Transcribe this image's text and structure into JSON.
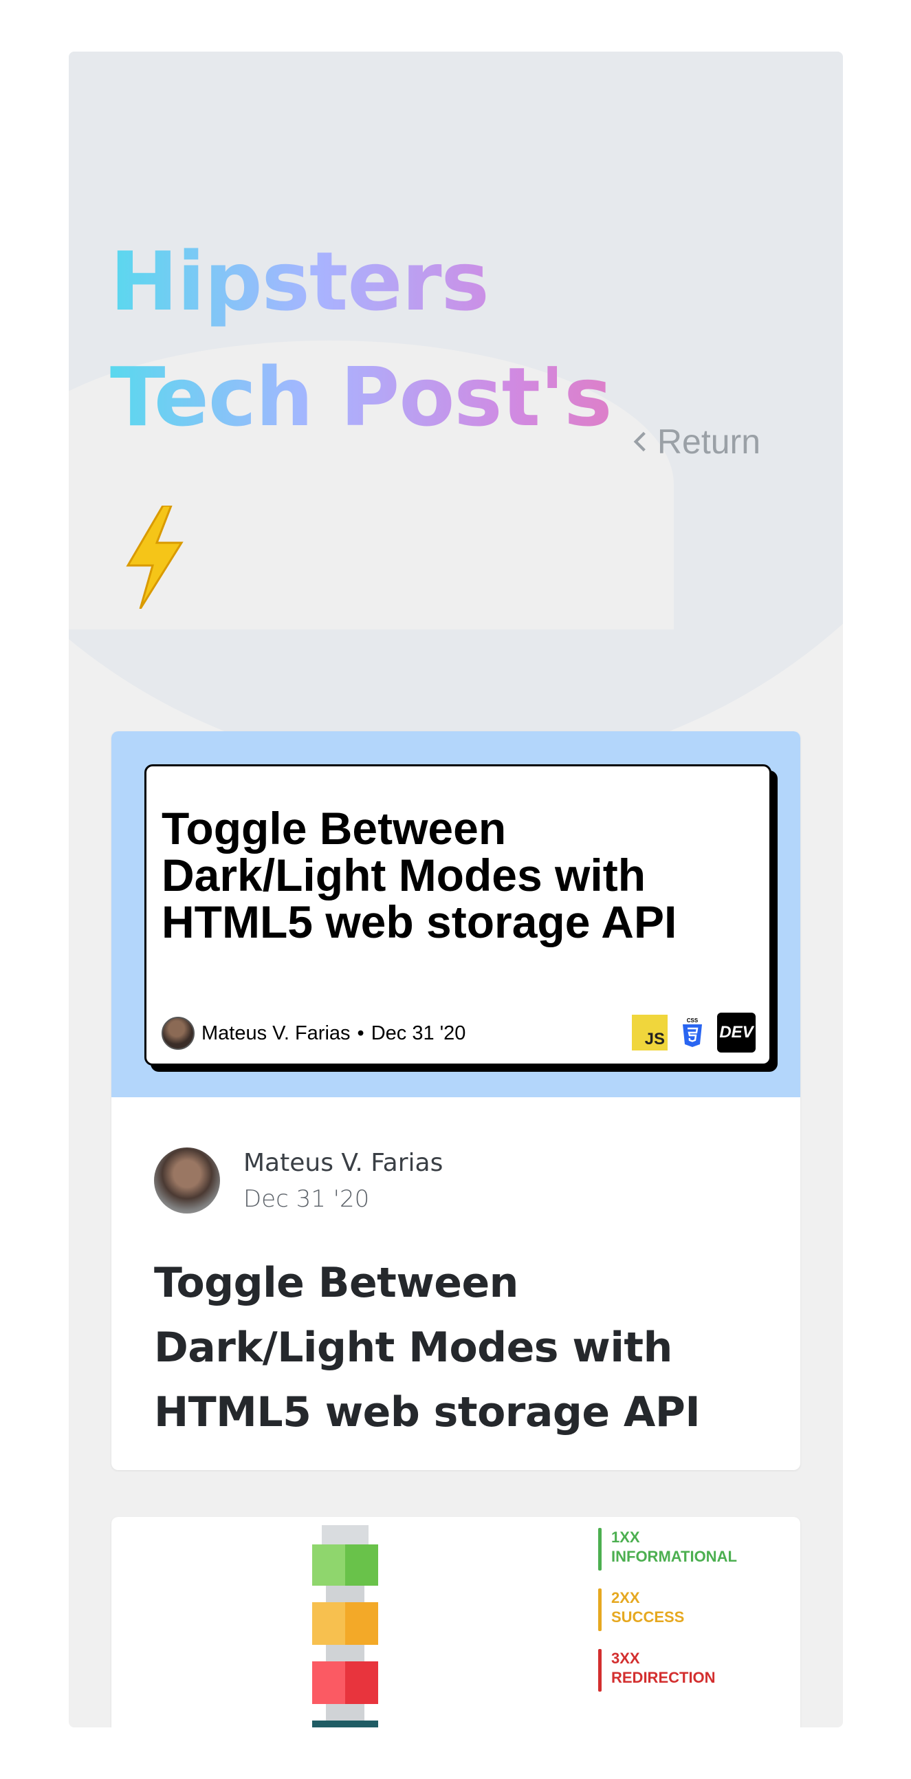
{
  "header": {
    "title_line1": "Hipsters",
    "title_line2": "Tech Post's",
    "emoji": "⚡",
    "return_label": "Return"
  },
  "posts": [
    {
      "cover": {
        "title": "Toggle Between Dark/Light Modes with HTML5 web storage API",
        "author": "Mateus V. Farias",
        "separator": "•",
        "date": "Dec 31 '20",
        "tags": [
          "JS",
          "CSS",
          "DEV"
        ]
      },
      "author": "Mateus V. Farias",
      "date": "Dec 31 '20",
      "title": "Toggle Between Dark/Light Modes with HTML5 web storage API"
    }
  ],
  "http_graphic": {
    "items": [
      {
        "code": "1XX",
        "label": "INFORMATIONAL",
        "color": "#4caf50"
      },
      {
        "code": "2XX",
        "label": "SUCCESS",
        "color": "#e6a820"
      },
      {
        "code": "3XX",
        "label": "REDIRECTION",
        "color": "#d32f2f"
      }
    ]
  },
  "colors": {
    "page_bg": "#f0f0f0",
    "cover_bg": "#b3d6fb",
    "gradient": [
      "#5ad8ee",
      "#a8b4ff",
      "#d08ae2",
      "#f56b98"
    ]
  }
}
